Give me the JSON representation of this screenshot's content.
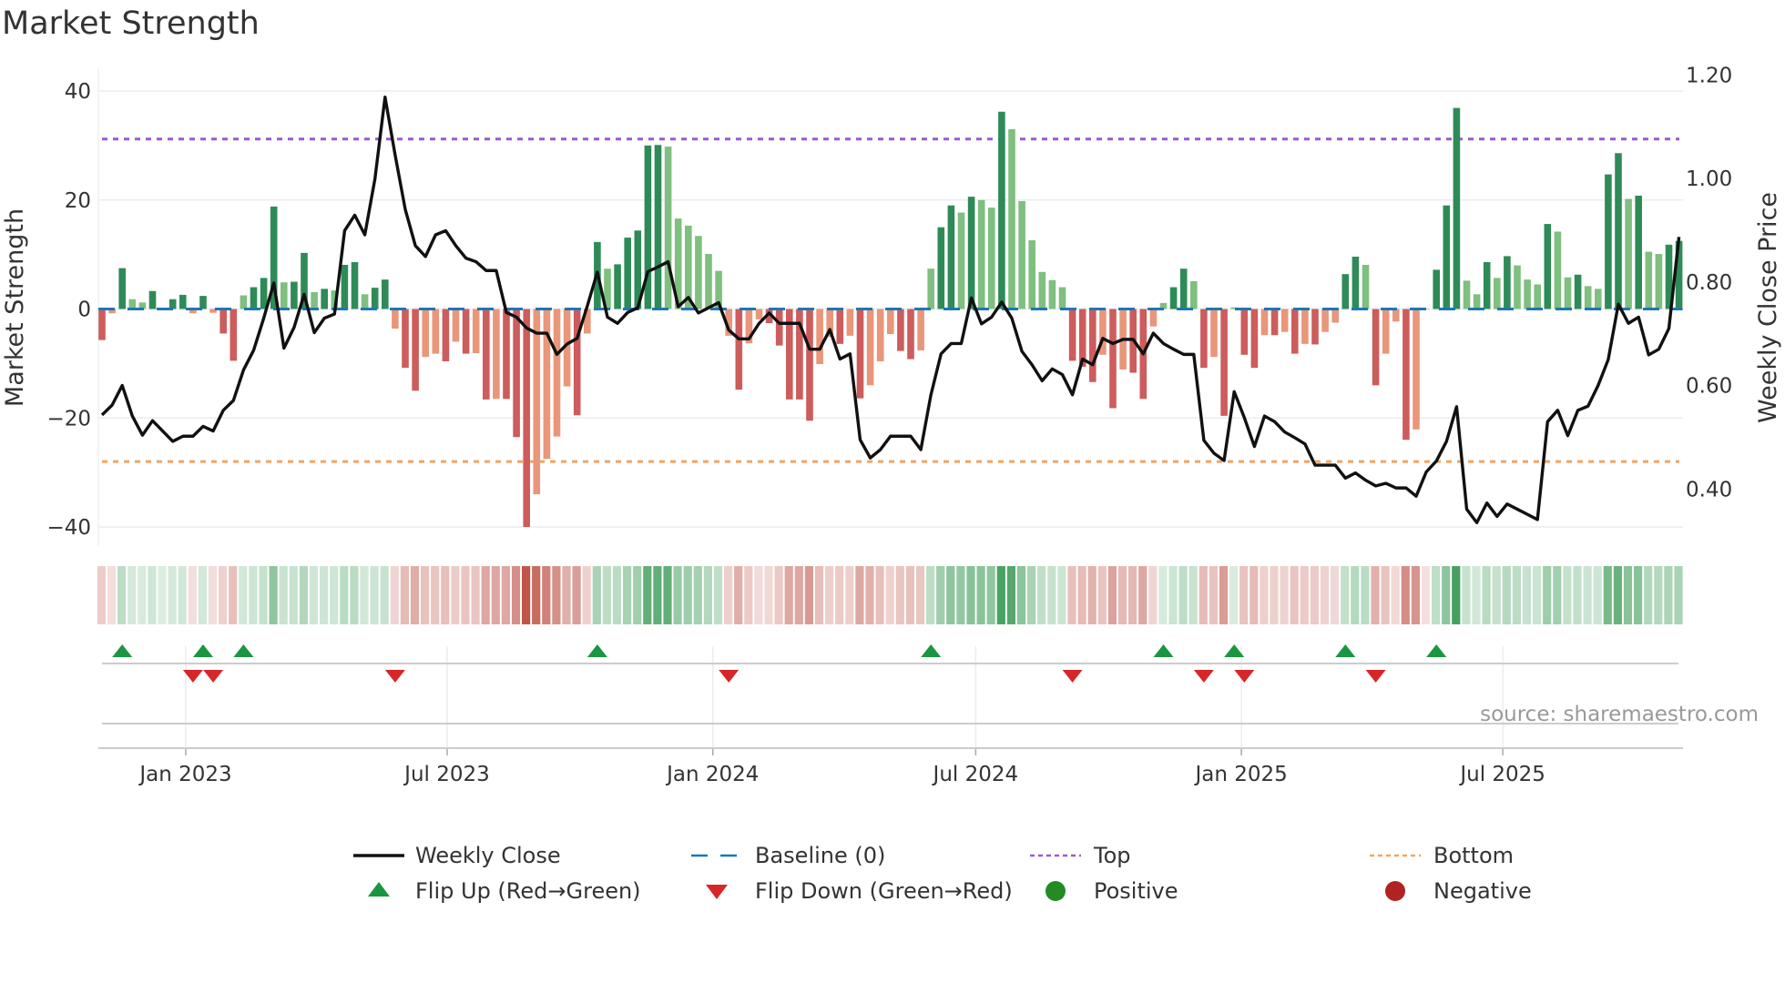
{
  "title": "Market Strength",
  "source": "source: sharemaestro.com",
  "chart_data": {
    "type": "bar",
    "title": "Market Strength",
    "x_start": "2022-11-04",
    "x_frequency": "weekly",
    "ylabel": "Market Strength",
    "ylabel_right": "Weekly Close Price",
    "ylim": [
      -42,
      42
    ],
    "ylim_right": [
      0.31,
      1.23
    ],
    "yticks": [
      "40",
      "20",
      "0",
      "−20",
      "−40"
    ],
    "ytick_values": [
      40,
      20,
      0,
      -20,
      -40
    ],
    "yticks_right": [
      "1.20",
      "1.00",
      "0.80",
      "0.60",
      "0.40"
    ],
    "ytick_right_values": [
      1.2,
      1.0,
      0.8,
      0.6,
      0.4
    ],
    "xticks": [
      {
        "label": "Jan 2023",
        "date": "2023-01-01"
      },
      {
        "label": "Jul 2023",
        "date": "2023-07-01"
      },
      {
        "label": "Jan 2024",
        "date": "2024-01-01"
      },
      {
        "label": "Jul 2024",
        "date": "2024-07-01"
      },
      {
        "label": "Jan 2025",
        "date": "2025-01-01"
      },
      {
        "label": "Jul 2025",
        "date": "2025-07-01"
      }
    ],
    "top_level": 31.2,
    "bottom_level": -28,
    "baseline": 0,
    "grid": true,
    "colors": {
      "pos_strong": "#2e8b57",
      "pos_weak": "#7fbf7f",
      "neg_strong": "#cd5c5c",
      "neg_weak": "#e9967a",
      "baseline": "#1f77b4",
      "top": "#9b59d6",
      "bottom": "#f4a460",
      "price": "#111111",
      "flip_up": "#1a9641",
      "flip_down": "#d62728",
      "positive": "#228b22",
      "negative": "#b22222"
    },
    "series": [
      {
        "name": "Market Strength",
        "values": [
          -5.7,
          -0.8,
          7.5,
          1.8,
          1.2,
          3.3,
          0.1,
          1.8,
          2.6,
          -0.8,
          2.4,
          -0.7,
          -4.5,
          -9.5,
          2.5,
          4.0,
          5.7,
          18.8,
          4.9,
          5.0,
          10.3,
          3.1,
          3.7,
          3.4,
          8.1,
          8.6,
          2.7,
          3.9,
          5.4,
          -3.6,
          -10.8,
          -15.0,
          -8.8,
          -8.2,
          -9.6,
          -6.0,
          -8.2,
          -8.1,
          -16.6,
          -16.5,
          -16.5,
          -23.5,
          -40.0,
          -34.0,
          -27.5,
          -23.4,
          -14.2,
          -19.5,
          -4.5,
          12.3,
          7.4,
          8.2,
          13.1,
          14.4,
          30.0,
          30.1,
          29.8,
          16.6,
          15.3,
          13.4,
          10.1,
          7.0,
          -4.9,
          -14.8,
          -6.3,
          -1.9,
          -2.6,
          -6.7,
          -16.6,
          -16.6,
          -20.5,
          -10.1,
          -5.1,
          -6.4,
          -4.9,
          -16.4,
          -14.0,
          -9.6,
          -4.6,
          -7.7,
          -9.2,
          -7.6,
          7.4,
          15.0,
          19.0,
          17.7,
          20.6,
          20.0,
          18.6,
          36.2,
          33.0,
          19.8,
          12.6,
          6.8,
          5.3,
          4.0,
          -9.5,
          -10.6,
          -13.4,
          -8.4,
          -18.2,
          -11.1,
          -11.7,
          -16.5,
          -3.2,
          1.1,
          4.0,
          7.4,
          5.1,
          -10.8,
          -8.8,
          -19.6,
          0.3,
          -8.4,
          -10.8,
          -4.8,
          -4.8,
          -4.2,
          -8.2,
          -6.4,
          -6.5,
          -4.2,
          -2.5,
          6.4,
          9.6,
          8.1,
          -14.0,
          -8.2,
          -2.3,
          -24.0,
          -22.1,
          -0.1,
          7.2,
          19.0,
          36.9,
          5.2,
          2.7,
          8.6,
          5.7,
          9.7,
          8.0,
          5.4,
          4.5,
          15.6,
          14.2,
          5.8,
          6.3,
          4.2,
          3.7,
          24.7,
          28.6,
          20.2,
          20.8,
          10.5,
          10.1,
          11.8,
          12.5
        ]
      },
      {
        "name": "Weekly Close",
        "axis": "right",
        "type": "line",
        "values": [
          0.543,
          0.562,
          0.6,
          0.541,
          0.504,
          0.532,
          0.512,
          0.492,
          0.502,
          0.502,
          0.521,
          0.512,
          0.552,
          0.571,
          0.63,
          0.668,
          0.73,
          0.798,
          0.672,
          0.712,
          0.776,
          0.702,
          0.73,
          0.738,
          0.899,
          0.929,
          0.891,
          0.999,
          1.157,
          1.045,
          0.94,
          0.87,
          0.849,
          0.891,
          0.899,
          0.87,
          0.846,
          0.839,
          0.822,
          0.822,
          0.741,
          0.732,
          0.711,
          0.701,
          0.701,
          0.66,
          0.68,
          0.691,
          0.753,
          0.819,
          0.732,
          0.72,
          0.741,
          0.75,
          0.82,
          0.829,
          0.839,
          0.752,
          0.77,
          0.74,
          0.75,
          0.76,
          0.707,
          0.69,
          0.69,
          0.72,
          0.74,
          0.72,
          0.72,
          0.72,
          0.67,
          0.67,
          0.708,
          0.651,
          0.661,
          0.495,
          0.46,
          0.476,
          0.502,
          0.502,
          0.502,
          0.476,
          0.582,
          0.661,
          0.681,
          0.681,
          0.769,
          0.719,
          0.732,
          0.761,
          0.73,
          0.666,
          0.64,
          0.609,
          0.632,
          0.621,
          0.582,
          0.651,
          0.64,
          0.691,
          0.681,
          0.689,
          0.689,
          0.661,
          0.701,
          0.681,
          0.67,
          0.66,
          0.66,
          0.494,
          0.469,
          0.455,
          0.588,
          0.538,
          0.482,
          0.541,
          0.53,
          0.51,
          0.499,
          0.487,
          0.446,
          0.446,
          0.446,
          0.421,
          0.431,
          0.417,
          0.406,
          0.411,
          0.402,
          0.402,
          0.386,
          0.433,
          0.454,
          0.492,
          0.559,
          0.361,
          0.335,
          0.373,
          0.347,
          0.371,
          0.361,
          0.351,
          0.341,
          0.53,
          0.552,
          0.503,
          0.552,
          0.56,
          0.6,
          0.65,
          0.757,
          0.72,
          0.732,
          0.659,
          0.67,
          0.71,
          0.887
        ]
      }
    ],
    "flip_up_weeks": [
      2,
      10,
      14,
      49,
      82,
      105,
      112,
      123,
      132
    ],
    "flip_down_weeks": [
      9,
      11,
      29,
      62,
      96,
      109,
      113,
      126
    ],
    "legend": {
      "placement": "bottom",
      "items": [
        {
          "label": "Weekly Close",
          "symbol": "line"
        },
        {
          "label": "Baseline (0)",
          "symbol": "dash"
        },
        {
          "label": "Top",
          "symbol": "dot-purple"
        },
        {
          "label": "Bottom",
          "symbol": "dot-orange"
        },
        {
          "label": "Flip Up (Red→Green)",
          "symbol": "triangle-up"
        },
        {
          "label": "Flip Down (Green→Red)",
          "symbol": "triangle-down"
        },
        {
          "label": "Positive",
          "symbol": "circle-green"
        },
        {
          "label": "Negative",
          "symbol": "circle-red"
        }
      ]
    }
  }
}
